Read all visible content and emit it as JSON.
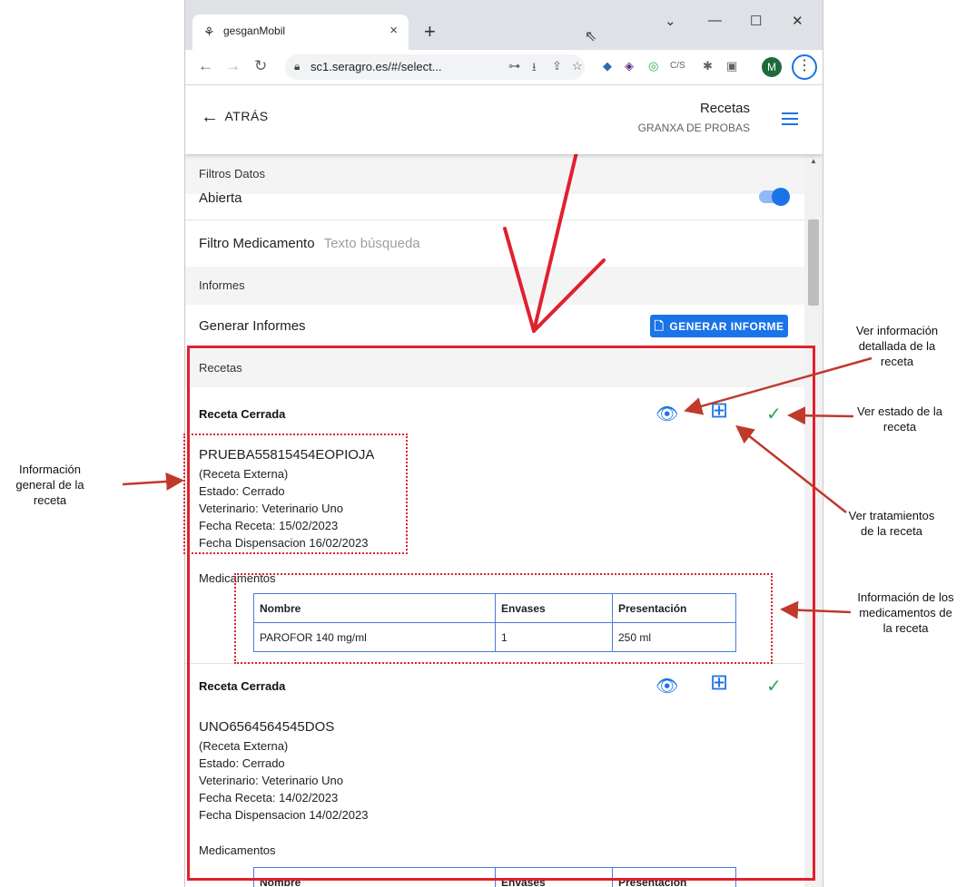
{
  "browser": {
    "tab_title": "gesganMobil",
    "tab_close": "×",
    "new_tab": "+",
    "url": "sc1.seragro.es/#/select...",
    "profile_initial": "M",
    "window_controls": [
      "⌄",
      "—",
      "☐",
      "✕"
    ],
    "extensions": [
      "⊶",
      "⭳",
      "⇪",
      "☆",
      "◆",
      "◈",
      "◎",
      "C/S",
      "✱",
      "▣"
    ]
  },
  "header": {
    "back_label": "ATRÁS",
    "title": "Recetas",
    "subtitle": "GRANXA DE PROBAS"
  },
  "filters": {
    "section_label": "Filtros Datos",
    "open_label": "Abierta",
    "open_enabled": true,
    "medication_filter_label": "Filtro Medicamento",
    "medication_filter_placeholder": "Texto búsqueda"
  },
  "reports": {
    "section_label": "Informes",
    "generate_label": "Generar Informes",
    "generate_button": "GENERAR INFORME"
  },
  "recipes": {
    "section_label": "Recetas",
    "items": [
      {
        "title": "Receta Cerrada",
        "code": "PRUEBA55815454EOPIOJA",
        "type": "(Receta Externa)",
        "status": "Estado: Cerrado",
        "vet": "Veterinario: Veterinario Uno",
        "date": "Fecha Receta: 15/02/2023",
        "dispensed": "Fecha Dispensacion 16/02/2023",
        "meds_label": "Medicamentos",
        "meds_headers": [
          "Nombre",
          "Envases",
          "Presentación"
        ],
        "meds_rows": [
          [
            "PAROFOR 140 mg/ml",
            "1",
            "250 ml"
          ]
        ]
      },
      {
        "title": "Receta Cerrada",
        "code": "UNO6564564545DOS",
        "type": "(Receta Externa)",
        "status": "Estado: Cerrado",
        "vet": "Veterinario: Veterinario Uno",
        "date": "Fecha Receta: 14/02/2023",
        "dispensed": "Fecha Dispensacion 14/02/2023",
        "meds_label": "Medicamentos",
        "meds_headers": [
          "Nombre",
          "Envases",
          "Presentación"
        ]
      }
    ]
  },
  "annotations": {
    "detail": [
      "Ver información",
      "detallada de la",
      "receta"
    ],
    "state": [
      "Ver estado de la",
      "receta"
    ],
    "treatments": [
      "Ver tratamientos",
      "de la receta"
    ],
    "general": [
      "Información",
      "general de la",
      "receta"
    ],
    "medications": [
      "Información de los",
      "medicamentos de",
      "la receta"
    ],
    "arrow_color": "#c0392b",
    "box_color": "#e0212e"
  }
}
